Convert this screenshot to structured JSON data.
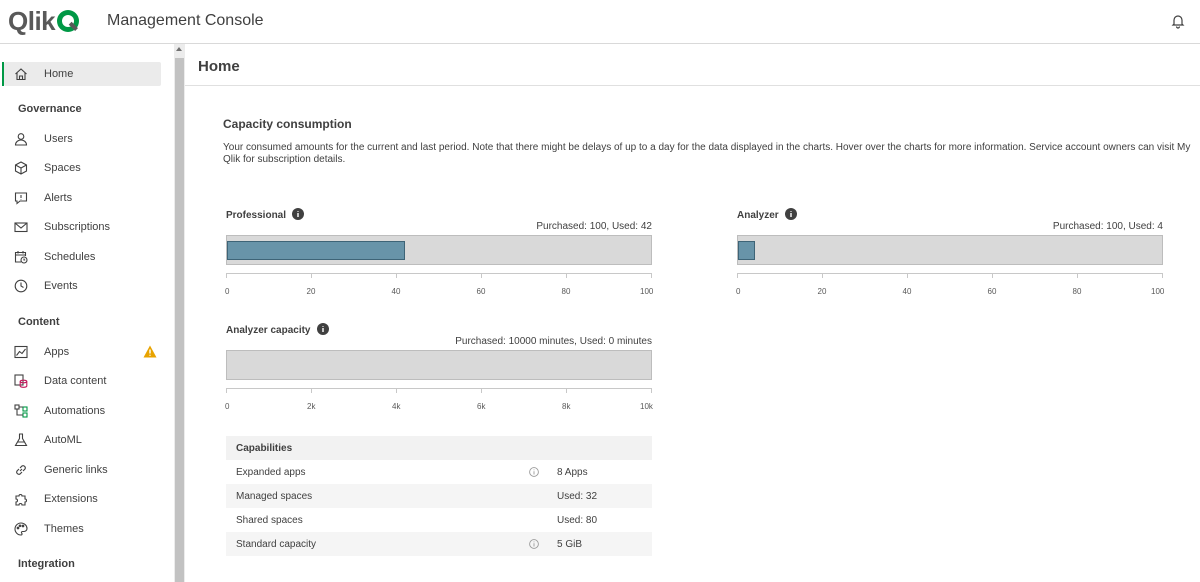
{
  "header": {
    "logo_text": "Qlik",
    "app_title": "Management Console",
    "notification_icon": "bell-icon"
  },
  "sidebar": {
    "home": {
      "label": "Home",
      "icon": "home-icon"
    },
    "sections": [
      {
        "title": "Governance"
      },
      {
        "title": "Content"
      },
      {
        "title": "Integration"
      }
    ],
    "governance_items": [
      {
        "label": "Users",
        "icon": "user-icon"
      },
      {
        "label": "Spaces",
        "icon": "cube-icon"
      },
      {
        "label": "Alerts",
        "icon": "alert-icon"
      },
      {
        "label": "Subscriptions",
        "icon": "mail-icon"
      },
      {
        "label": "Schedules",
        "icon": "calendar-clock-icon"
      },
      {
        "label": "Events",
        "icon": "clock-icon"
      }
    ],
    "content_items": [
      {
        "label": "Apps",
        "icon": "app-chart-icon",
        "warning": true
      },
      {
        "label": "Data content",
        "icon": "database-icon"
      },
      {
        "label": "Automations",
        "icon": "automation-icon"
      },
      {
        "label": "AutoML",
        "icon": "flask-icon"
      },
      {
        "label": "Generic links",
        "icon": "link-icon"
      },
      {
        "label": "Extensions",
        "icon": "puzzle-icon"
      },
      {
        "label": "Themes",
        "icon": "palette-icon"
      }
    ]
  },
  "main": {
    "page_title": "Home",
    "card_title": "Capacity consumption",
    "card_description": "Your consumed amounts for the current and last period. Note that there might be delays of up to a day for the data displayed in the charts. Hover over the charts for more information. Service account owners can visit My Qlik for subscription details.",
    "meters": [
      {
        "title": "Professional",
        "summary": "Purchased: 100, Used: 42",
        "purchased": 100,
        "used": 42,
        "max": 100,
        "ticks": [
          "0",
          "20",
          "40",
          "60",
          "80",
          "100"
        ]
      },
      {
        "title": "Analyzer",
        "summary": "Purchased: 100, Used: 4",
        "purchased": 100,
        "used": 4,
        "max": 100,
        "ticks": [
          "0",
          "20",
          "40",
          "60",
          "80",
          "100"
        ]
      },
      {
        "title": "Analyzer capacity",
        "summary": "Purchased: 10000 minutes, Used: 0 minutes",
        "purchased": 10000,
        "used": 0,
        "max": 10000,
        "ticks": [
          "0",
          "2k",
          "4k",
          "6k",
          "8k",
          "10k"
        ]
      }
    ],
    "capabilities": {
      "header": "Capabilities",
      "rows": [
        {
          "name": "Expanded apps",
          "info": true,
          "value": "8 Apps"
        },
        {
          "name": "Managed spaces",
          "info": false,
          "value": "Used: 32"
        },
        {
          "name": "Shared spaces",
          "info": false,
          "value": "Used: 80"
        },
        {
          "name": "Standard capacity",
          "info": true,
          "value": "5 GiB"
        }
      ]
    }
  },
  "colors": {
    "brand_green": "#009845",
    "meter_fill": "#6894a9",
    "meter_track": "#d9d9d9",
    "warning": "#e8a300"
  }
}
